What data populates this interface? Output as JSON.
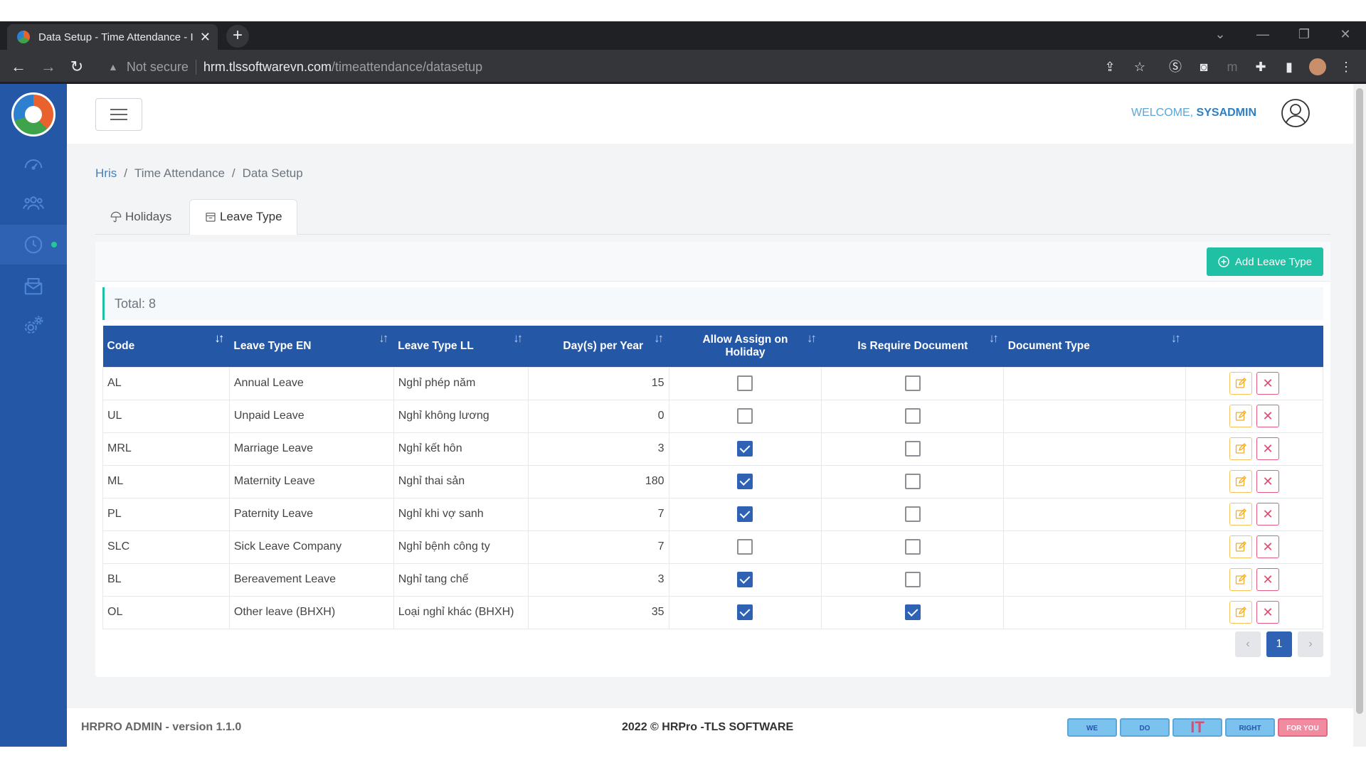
{
  "browser": {
    "tab_title": "Data Setup - Time Attendance - I",
    "close_glyph": "✕",
    "new_tab_glyph": "+",
    "security_warning": "▲",
    "not_secure": "Not secure",
    "url_host": "hrm.tlssoftwarevn.com",
    "url_path": "/timeattendance/datasetup"
  },
  "header": {
    "welcome_prefix": "WELCOME, ",
    "username": "SYSADMIN"
  },
  "breadcrumb": {
    "items": [
      "Hris",
      "Time Attendance",
      "Data Setup"
    ],
    "separator": "/"
  },
  "tabs": [
    {
      "label": "Holidays",
      "icon": "umbrella-icon",
      "active": false
    },
    {
      "label": "Leave Type",
      "icon": "calendar-icon",
      "active": true
    }
  ],
  "toolbar": {
    "add_label": "Add Leave Type"
  },
  "total_label": "Total: 8",
  "table": {
    "columns": [
      "Code",
      "Leave Type EN",
      "Leave Type LL",
      "Day(s) per Year",
      "Allow Assign on Holiday",
      "Is Require Document",
      "Document Type"
    ],
    "rows": [
      {
        "code": "AL",
        "en": "Annual Leave",
        "ll": "Nghỉ phép năm",
        "days": "15",
        "holiday": false,
        "doc": false,
        "doctype": ""
      },
      {
        "code": "UL",
        "en": "Unpaid Leave",
        "ll": "Nghỉ không lương",
        "days": "0",
        "holiday": false,
        "doc": false,
        "doctype": ""
      },
      {
        "code": "MRL",
        "en": "Marriage Leave",
        "ll": "Nghỉ kết hôn",
        "days": "3",
        "holiday": true,
        "doc": false,
        "doctype": ""
      },
      {
        "code": "ML",
        "en": "Maternity Leave",
        "ll": "Nghỉ thai sản",
        "days": "180",
        "holiday": true,
        "doc": false,
        "doctype": ""
      },
      {
        "code": "PL",
        "en": "Paternity Leave",
        "ll": "Nghỉ khi vợ sanh",
        "days": "7",
        "holiday": true,
        "doc": false,
        "doctype": ""
      },
      {
        "code": "SLC",
        "en": "Sick Leave Company",
        "ll": "Nghỉ bệnh công ty",
        "days": "7",
        "holiday": false,
        "doc": false,
        "doctype": ""
      },
      {
        "code": "BL",
        "en": "Bereavement Leave",
        "ll": "Nghỉ tang chế",
        "days": "3",
        "holiday": true,
        "doc": false,
        "doctype": ""
      },
      {
        "code": "OL",
        "en": "Other leave (BHXH)",
        "ll": "Loại nghỉ khác (BHXH)",
        "days": "35",
        "holiday": true,
        "doc": true,
        "doctype": ""
      }
    ],
    "delete_glyph": "✕"
  },
  "pagination": {
    "prev": "‹",
    "current": "1",
    "next": "›"
  },
  "footer": {
    "version": "HRPRO ADMIN - version 1.1.0",
    "copyright": "2022 © HRPro -TLS SOFTWARE",
    "tags": [
      "WE",
      "DO",
      "IT",
      "RIGHT",
      "FOR YOU"
    ]
  },
  "colors": {
    "primary": "#2557a7",
    "accent": "#20c0a4",
    "edit": "#f0ad28",
    "delete": "#e04a6f"
  }
}
